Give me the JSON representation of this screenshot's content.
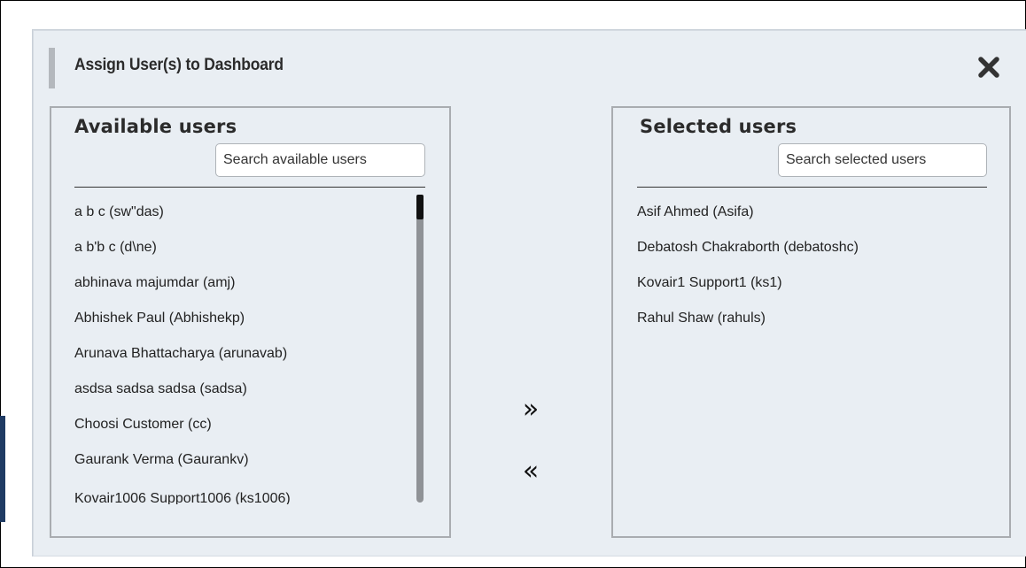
{
  "dialog": {
    "title": "Assign User(s) to Dashboard",
    "close_icon": "close-icon"
  },
  "available": {
    "title": "Available users",
    "search_placeholder": "Search available users",
    "items": [
      "a b c (sw\"das)",
      "a b'b c (d\\ne)",
      "abhinava majumdar (amj)",
      "Abhishek Paul (Abhishekp)",
      "Arunava Bhattacharya (arunavab)",
      "asdsa sadsa sadsa (sadsa)",
      "Choosi Customer (cc)",
      "Gaurank Verma (Gaurankv)",
      "Kovair1006 Support1006 (ks1006)"
    ]
  },
  "selected": {
    "title": "Selected users",
    "search_placeholder": "Search selected users",
    "items": [
      "Asif Ahmed (Asifa)",
      "Debatosh Chakraborth (debatoshc)",
      "Kovair1 Support1 (ks1)",
      "Rahul Shaw (rahuls)"
    ]
  },
  "actions": {
    "move_right": "»",
    "move_left": "«"
  }
}
